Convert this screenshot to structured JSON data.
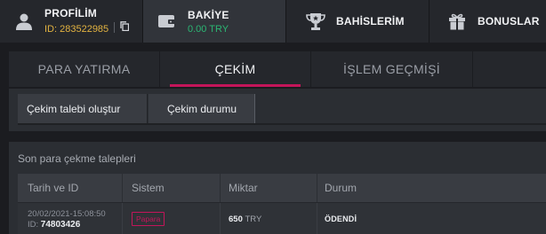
{
  "nav": {
    "profile": {
      "title": "PROFİLİM",
      "id_text": "ID: 283522985",
      "icon": "user-icon"
    },
    "balance": {
      "title": "BAKİYE",
      "amount": "0.00 TRY",
      "icon": "wallet-icon"
    },
    "bets": {
      "title": "BAHİSLERİM",
      "icon": "trophy-icon"
    },
    "bonus": {
      "title": "BONUSLAR",
      "icon": "gift-icon"
    }
  },
  "tabs": [
    {
      "label": "PARA YATIRMA",
      "active": false
    },
    {
      "label": "ÇEKİM",
      "active": true
    },
    {
      "label": "İŞLEM GEÇMİŞİ",
      "active": false
    },
    {
      "label": "",
      "active": false
    }
  ],
  "subtabs": [
    {
      "label": "Çekim talebi oluştur",
      "active": false
    },
    {
      "label": "Çekim durumu",
      "active": true
    }
  ],
  "requests": {
    "title": "Son para çekme talepleri",
    "columns": [
      "Tarih ve ID",
      "Sistem",
      "Miktar",
      "Durum"
    ],
    "rows": [
      {
        "date": "20/02/2021-15:08:50",
        "id_prefix": "ID:",
        "id": "74803426",
        "system": "Papara",
        "amount": "650",
        "currency": "TRY",
        "status": "ÖDENDİ"
      }
    ]
  },
  "colors": {
    "accent": "#c4155a",
    "money": "#2bb673",
    "id": "#e3b341"
  }
}
